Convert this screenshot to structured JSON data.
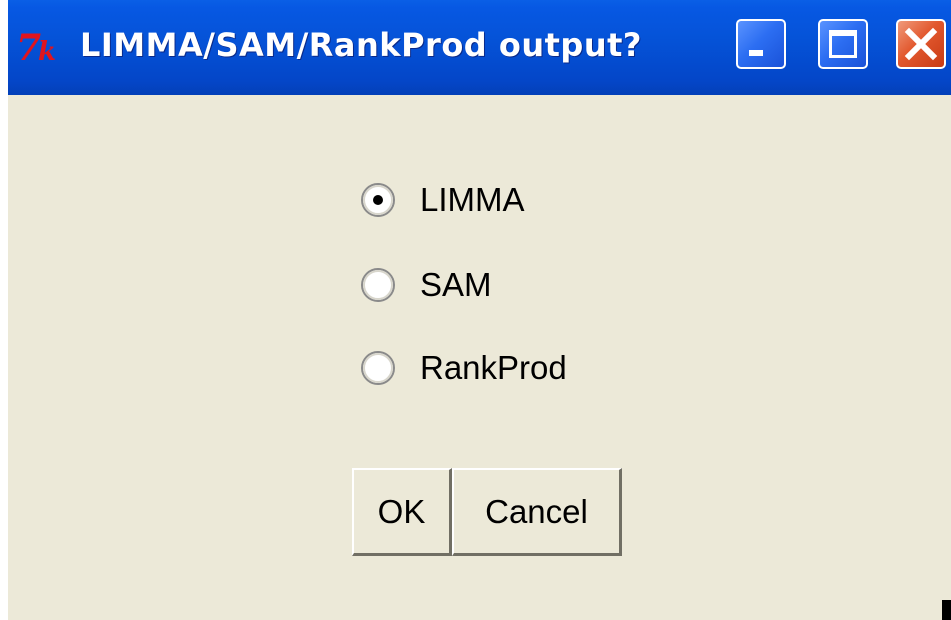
{
  "window": {
    "title": "LIMMA/SAM/RankProd output?",
    "controls": {
      "minimize": "minimize-icon",
      "maximize": "maximize-icon",
      "close": "close-icon"
    }
  },
  "options": [
    {
      "label": "LIMMA",
      "selected": true
    },
    {
      "label": "SAM",
      "selected": false
    },
    {
      "label": "RankProd",
      "selected": false
    }
  ],
  "buttons": {
    "ok_label": "OK",
    "cancel_label": "Cancel"
  },
  "colors": {
    "titlebar": "#0553d8",
    "dialog_bg": "#ece9d8",
    "close_button": "#e2582e"
  }
}
